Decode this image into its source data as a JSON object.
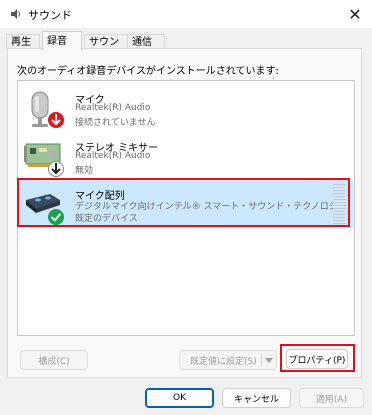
{
  "window": {
    "title": "サウンド",
    "close_glyph": "✕"
  },
  "tabs": [
    {
      "label": "再生",
      "active": false
    },
    {
      "label": "録音",
      "active": true
    },
    {
      "label": "サウンド",
      "active": false
    },
    {
      "label": "通信",
      "active": false
    }
  ],
  "instruction": "次のオーディオ録音デバイスがインストールされています:",
  "devices": [
    {
      "name": "マイク",
      "driver": "Realtek(R) Audio",
      "status": "接続されていません",
      "icon": "microphone-icon",
      "badge": "red-down-arrow-icon",
      "selected": false
    },
    {
      "name": "ステレオ ミキサー",
      "driver": "Realtek(R) Audio",
      "status": "無効",
      "icon": "sound-card-icon",
      "badge": "black-down-arrow-icon",
      "selected": false
    },
    {
      "name": "マイク配列",
      "driver": "デジタルマイク向けインテル® スマート・サウンド・テクノロジー",
      "status": "既定のデバイス",
      "icon": "mic-array-icon",
      "badge": "green-check-icon",
      "selected": true
    }
  ],
  "buttons": {
    "configure": "構成(C)",
    "set_default": "既定値に設定(S)",
    "properties": "プロパティ(P)",
    "ok": "OK",
    "cancel": "キャンセル",
    "apply": "適用(A)"
  },
  "colors": {
    "accent": "#005fb8",
    "selection": "#cce8ff",
    "highlight_box": "#d7141e"
  }
}
